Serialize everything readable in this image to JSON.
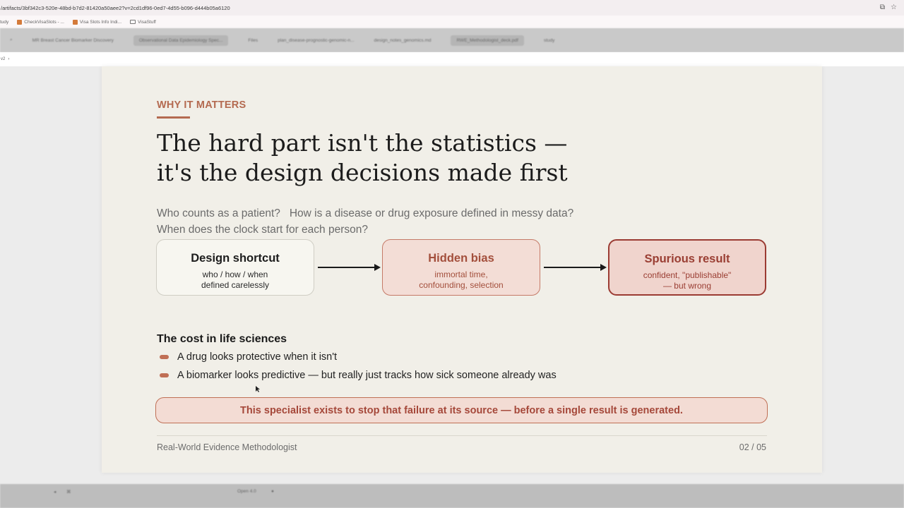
{
  "browser": {
    "url": "/artifacts/3bf342c3-520e-48bd-b7d2-81420a50aee2?v=2cd1df96-0ed7-4d55-b096-d444b05a6120",
    "bookmarks": [
      "tudy",
      "CheckVisaSlots - ...",
      "Visa Slots Info Indi...",
      "VisaStuff"
    ],
    "tabs": [
      "MR Breast Cancer Biomarker Discovery",
      "Observational Data Epidemiology Spec...",
      "Files",
      "plan_disease-prognostic-genomic-n...",
      "design_notes_genomics.md",
      "RWE_Methodologist_deck.pdf",
      "study"
    ],
    "subbar_label": "v2",
    "bottom_items": [
      "Open 4.0"
    ]
  },
  "slide": {
    "eyebrow": "WHY IT MATTERS",
    "headline_line1": "The hard part isn't the statistics —",
    "headline_line2": "it's the design decisions made first",
    "lede_line1": "Who counts as a patient?   How is a disease or drug exposure defined in messy data?",
    "lede_line2": "When does the clock start for each person?",
    "flow": [
      {
        "title": "Design shortcut",
        "line1": "who / how / when",
        "line2": "defined carelessly"
      },
      {
        "title": "Hidden bias",
        "line1": "immortal time,",
        "line2": "confounding, selection"
      },
      {
        "title": "Spurious result",
        "line1": "confident, \"publishable\"",
        "line2": "— but wrong"
      }
    ],
    "cost_heading": "The cost in life sciences",
    "bullets": [
      "A drug looks protective when it isn't",
      "A biomarker looks predictive — but really just tracks how sick someone already was"
    ],
    "callout": "This specialist exists to stop that failure at its source — before a single result is generated.",
    "footer_left": "Real-World Evidence Methodologist",
    "footer_right": "02 / 05"
  },
  "colors": {
    "accent": "#b46a50",
    "slide_bg": "#f1efe8",
    "bias_fill": "#f3ddd6",
    "result_border": "#9b3b33"
  }
}
